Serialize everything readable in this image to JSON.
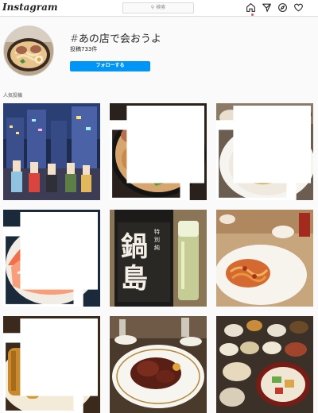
{
  "header": {
    "logo_text": "Instagram",
    "search_placeholder": "検索",
    "nav": [
      "home-icon",
      "direct-icon",
      "explore-icon",
      "activity-heart-icon"
    ]
  },
  "tag": {
    "name": "#あの店で会おうよ",
    "post_count": "投稿733件",
    "follow_label": "フォローする"
  },
  "section": {
    "label": "人気投稿"
  },
  "posts": [
    {
      "subject": "anime-street-illustration",
      "multi": false
    },
    {
      "subject": "ramen-bowl",
      "multi": true
    },
    {
      "subject": "steak-salad-plate",
      "multi": true
    },
    {
      "subject": "seafood-rice-bowl",
      "multi": true
    },
    {
      "subject": "sake-bottle-with-glass",
      "multi": false
    },
    {
      "subject": "pasta-plate",
      "multi": false
    },
    {
      "subject": "fried-fish-with-herbs",
      "multi": true
    },
    {
      "subject": "stew-on-plate",
      "multi": false
    },
    {
      "subject": "kaiseki-tray",
      "multi": false
    }
  ],
  "colors": {
    "brand_blue": "#0095f6",
    "activity_dot": "#ed4956",
    "border": "#dbdbdb"
  }
}
